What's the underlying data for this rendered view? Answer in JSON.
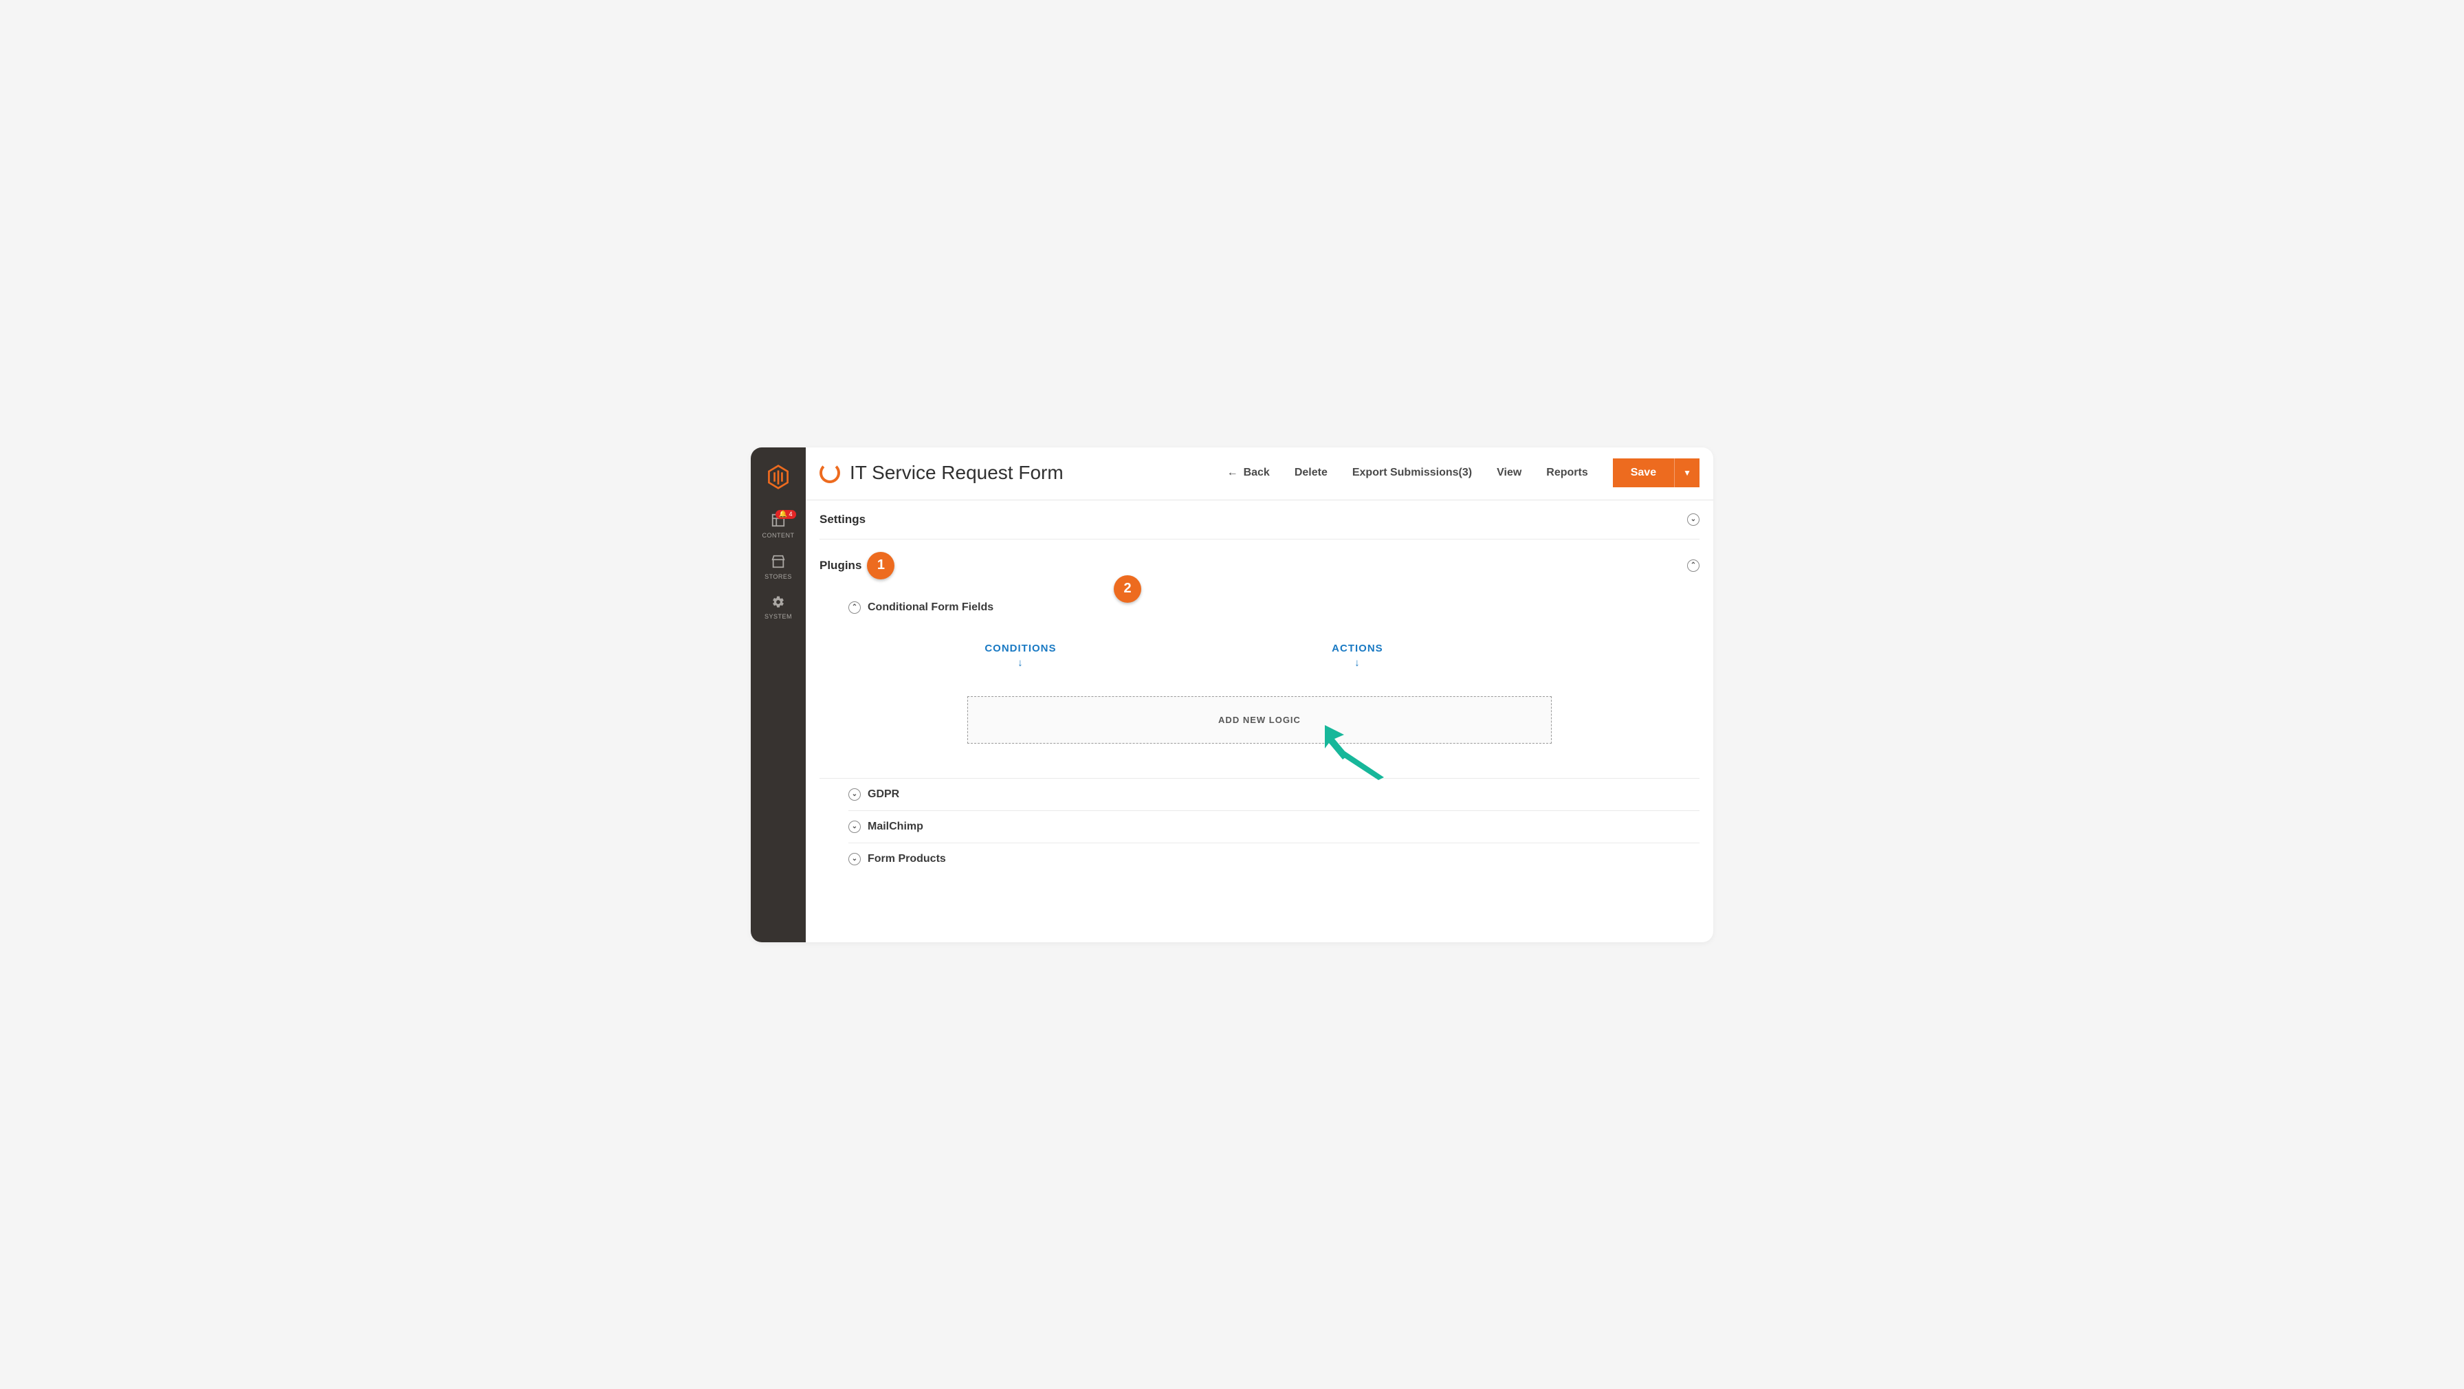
{
  "sidebar": {
    "items": [
      {
        "label": "CONTENT",
        "badge": "4"
      },
      {
        "label": "STORES"
      },
      {
        "label": "SYSTEM"
      }
    ]
  },
  "header": {
    "title": "IT Service Request Form",
    "back": "Back",
    "delete": "Delete",
    "export": "Export Submissions(3)",
    "view": "View",
    "reports": "Reports",
    "save": "Save"
  },
  "sections": {
    "settings": "Settings",
    "plugins": "Plugins"
  },
  "callouts": {
    "one": "1",
    "two": "2"
  },
  "plugins": {
    "conditional": "Conditional Form Fields",
    "gdpr": "GDPR",
    "mailchimp": "MailChimp",
    "form_products": "Form Products"
  },
  "conditional": {
    "conditions_label": "CONDITIONS",
    "actions_label": "ACTIONS",
    "add_button": "ADD NEW LOGIC"
  }
}
